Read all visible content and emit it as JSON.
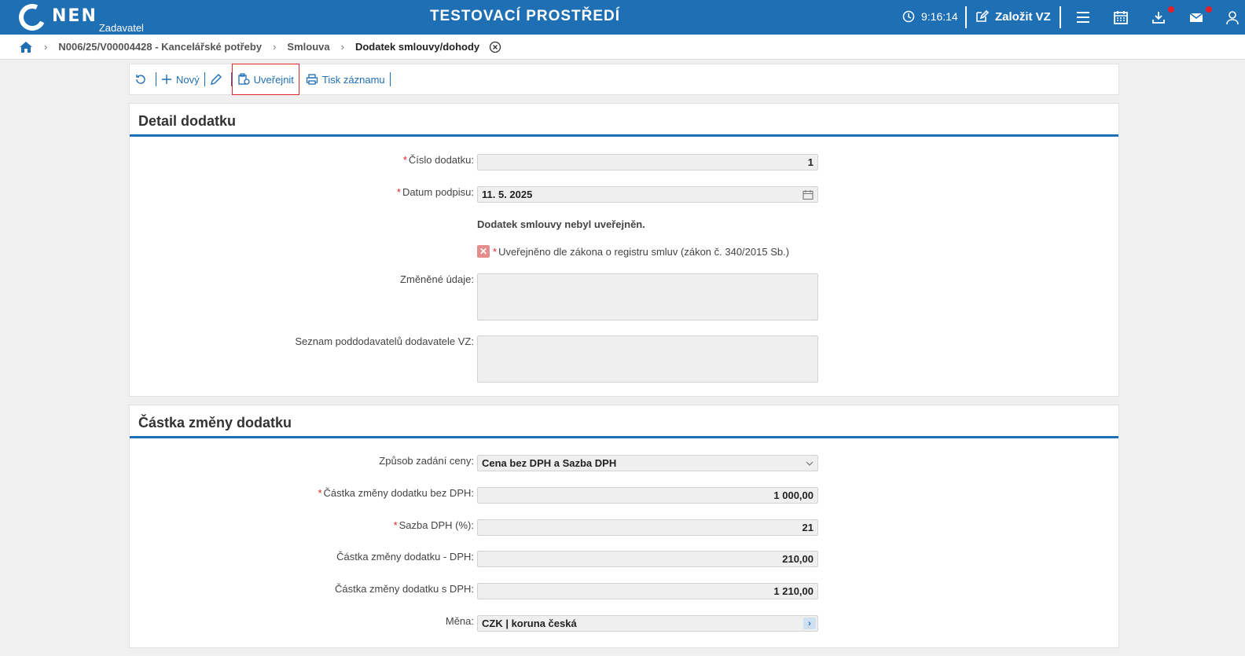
{
  "header": {
    "logo_text": "NEN",
    "logo_sub": "Zadavatel",
    "env_title": "TESTOVACÍ PROSTŘEDÍ",
    "clock": "9:16:14",
    "new_vz_label": "Založit VZ"
  },
  "breadcrumb": {
    "items": [
      "N006/25/V00004428 - Kancelářské potřeby",
      "Smlouva"
    ],
    "current": "Dodatek smlouvy/dohody"
  },
  "toolbar": {
    "new_label": "Nový",
    "publish_label": "Uveřejnit",
    "print_label": "Tisk záznamu"
  },
  "detail": {
    "title": "Detail dodatku",
    "cislo_label": "Číslo dodatku:",
    "cislo_value": "1",
    "datum_label": "Datum podpisu:",
    "datum_value": "11. 5. 2025",
    "status_note": "Dodatek smlouvy nebyl uveřejněn.",
    "published_check_label": "Uveřejněno dle zákona o registru smluv (zákon č. 340/2015 Sb.)",
    "zmenene_label": "Změněné údaje:",
    "seznam_label": "Seznam poddodavatelů dodavatele VZ:"
  },
  "amount": {
    "title": "Částka změny dodatku",
    "zpusob_label": "Způsob zadání ceny:",
    "zpusob_value": "Cena bez DPH a Sazba DPH",
    "bez_dph_label": "Částka změny dodatku bez DPH:",
    "bez_dph_value": "1 000,00",
    "sazba_label": "Sazba DPH (%):",
    "sazba_value": "21",
    "dph_label": "Částka změny dodatku - DPH:",
    "dph_value": "210,00",
    "s_dph_label": "Částka změny dodatku s DPH:",
    "s_dph_value": "1 210,00",
    "mena_label": "Měna:",
    "mena_value": "CZK | koruna česká"
  }
}
